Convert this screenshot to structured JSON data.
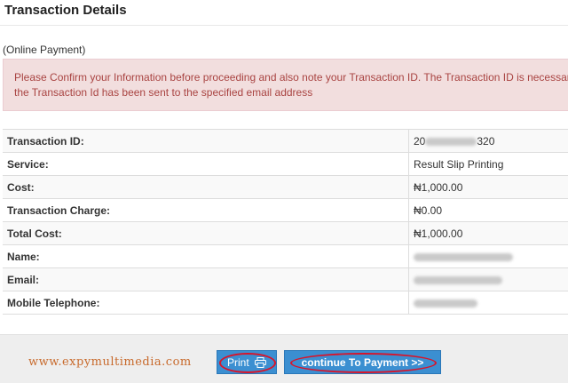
{
  "page": {
    "title": "Transaction Details",
    "subtitle": "(Online Payment)"
  },
  "alert": {
    "line1": "Please Confirm your Information before proceeding and also note your Transaction ID. The Transaction ID is necessary",
    "line2": "the Transaction Id has been sent to the specified email address",
    "colors": {
      "background": "#f2dede",
      "text": "#a94442",
      "border": "#ebccd1"
    }
  },
  "details": {
    "rows": [
      {
        "label": "Transaction ID:",
        "value_prefix": "20",
        "value_suffix": "320",
        "partially_redacted": true
      },
      {
        "label": "Service:",
        "value": "Result Slip Printing"
      },
      {
        "label": "Cost:",
        "value": "₦1,000.00"
      },
      {
        "label": "Transaction Charge:",
        "value": "₦0.00"
      },
      {
        "label": "Total Cost:",
        "value": "₦1,000.00"
      },
      {
        "label": "Name:",
        "value": "",
        "redacted": true
      },
      {
        "label": "Email:",
        "value": "",
        "redacted": true
      },
      {
        "label": "Mobile Telephone:",
        "value": "",
        "redacted": true
      }
    ]
  },
  "footer": {
    "watermark": "www.expymultimedia.com",
    "print_label": "Print",
    "print_icon": "printer-icon",
    "continue_label": "continue To Payment >>",
    "colors": {
      "button": "#3b8fd1",
      "highlight_ring": "#d8142a",
      "watermark": "#c86a2c"
    }
  }
}
